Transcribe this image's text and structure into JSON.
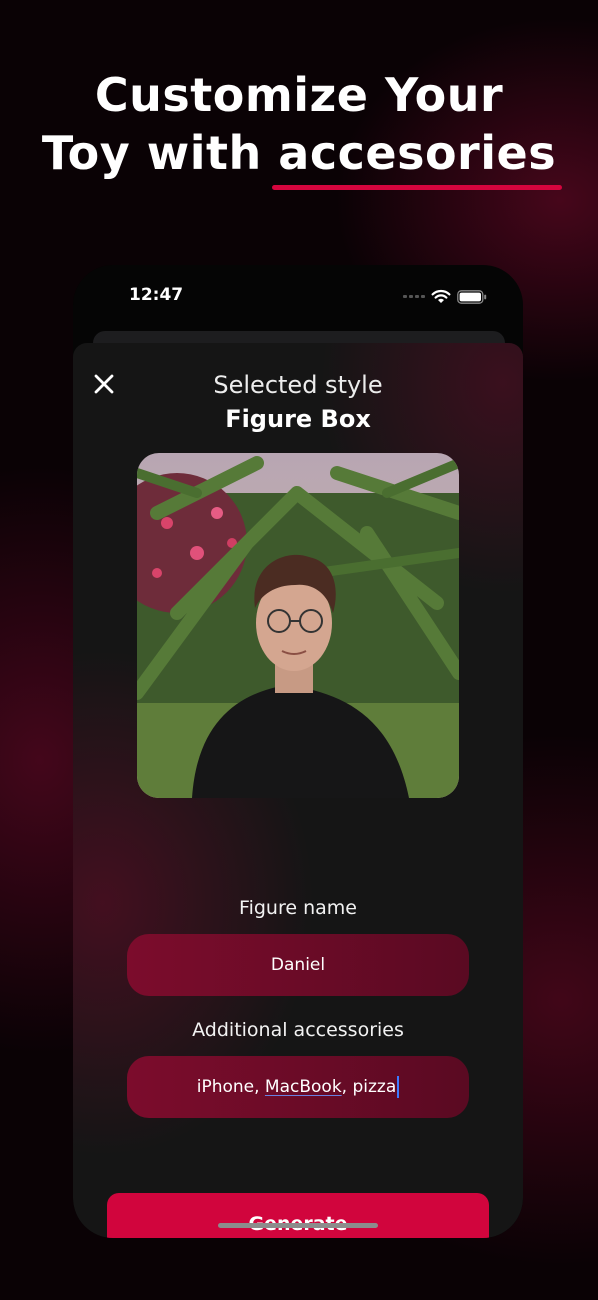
{
  "headline": {
    "line1": "Customize Your",
    "line2_prefix": "Toy with ",
    "line2_highlight": "accesories"
  },
  "status_bar": {
    "time": "12:47"
  },
  "sheet": {
    "title": "Selected style",
    "subtitle": "Figure Box",
    "figure_name_label": "Figure name",
    "figure_name_value": "Daniel",
    "accessories_label": "Additional accessories",
    "accessories_value": {
      "part1": "iPhone, ",
      "part2": "MacBook",
      "part3": ", pizza"
    },
    "generate_label": "Generate"
  },
  "colors": {
    "accent": "#d1053d",
    "field_bg": "#7c0c2c",
    "sheet_bg": "#151515"
  }
}
